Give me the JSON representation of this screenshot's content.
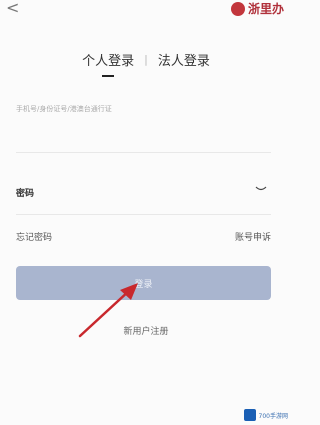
{
  "header": {
    "back_glyph": "<",
    "brand_text": "浙里办"
  },
  "tabs": [
    {
      "label": "个人登录",
      "active": true
    },
    {
      "label": "法人登录",
      "active": false
    }
  ],
  "tab_separator": "|",
  "account": {
    "placeholder": "手机号/身份证号/港澳台通行证"
  },
  "password": {
    "label": "密码"
  },
  "links": {
    "forgot": "忘记密码",
    "appeal": "账号申诉"
  },
  "login_button": {
    "label": "登录",
    "color": "#a9b5cf"
  },
  "register_link": "新用户注册",
  "annotation": {
    "arrow_color": "#c8282d"
  },
  "watermark": {
    "text": "700手游网"
  }
}
